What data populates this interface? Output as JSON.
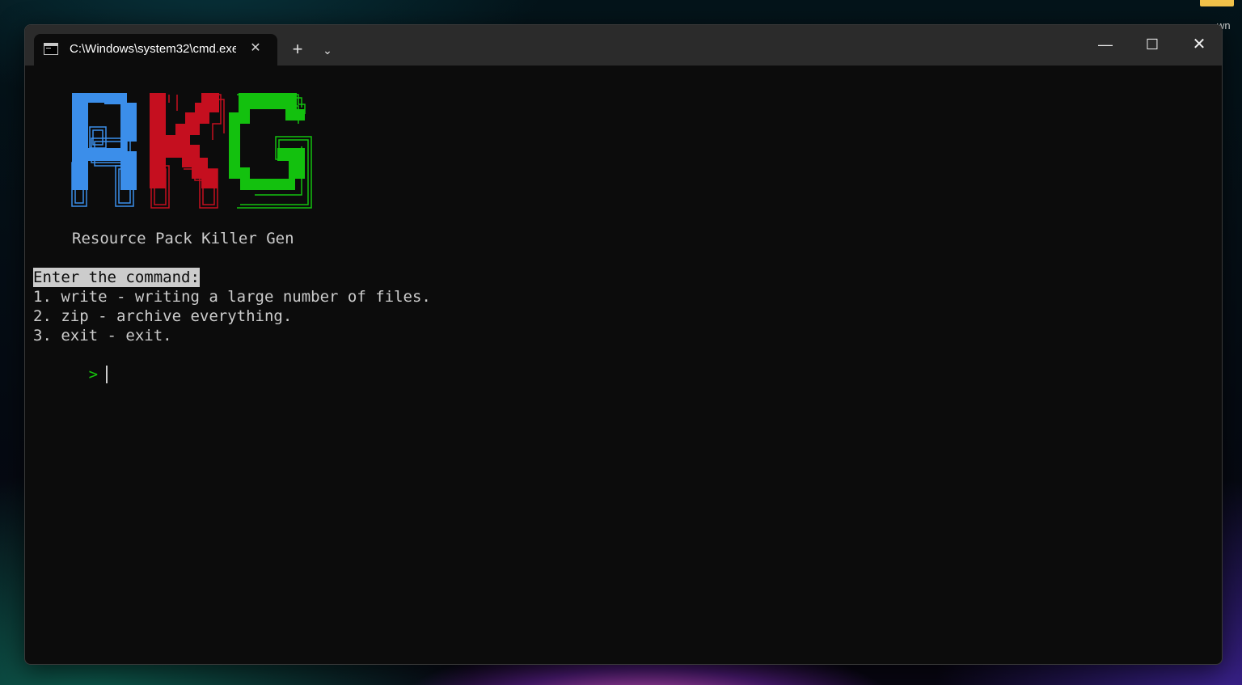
{
  "desktop": {
    "icon_label": "wn"
  },
  "window": {
    "tab_title": "C:\\Windows\\system32\\cmd.exe",
    "tab_icon": "terminal-icon",
    "tab_close_glyph": "✕",
    "new_tab_glyph": "+",
    "dropdown_glyph": "⌄",
    "minimize_glyph": "—",
    "maximize_glyph": "☐",
    "close_glyph": "✕"
  },
  "console": {
    "logo": {
      "letters": [
        "R",
        "K",
        "G"
      ],
      "colors": [
        "#3b8eea",
        "#c50f1f",
        "#13c10e"
      ]
    },
    "subtitle": "Resource Pack Killer Gen",
    "prompt_heading": "Enter the command:",
    "options": [
      "1. write - writing a large number of files.",
      "2. zip - archive everything.",
      "3. exit - exit."
    ],
    "prompt_symbol": ">",
    "input_value": ""
  }
}
